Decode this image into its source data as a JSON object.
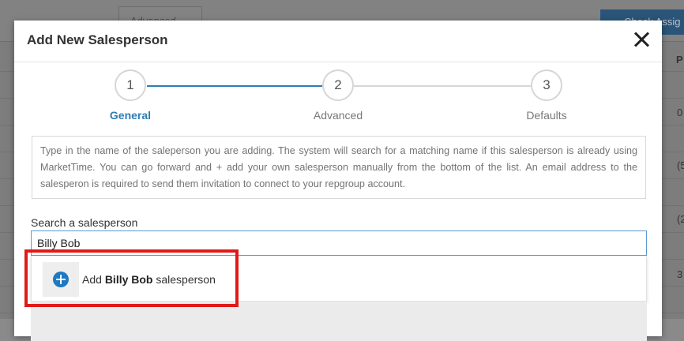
{
  "background": {
    "advanced_button": "Advanced ⌄",
    "check_button": "Check Assig",
    "column_header": "P",
    "cells": [
      "0",
      "(5",
      "(2",
      "3"
    ]
  },
  "modal": {
    "title": "Add New Salesperson",
    "steps": [
      {
        "number": "1",
        "label": "General",
        "active": true
      },
      {
        "number": "2",
        "label": "Advanced",
        "active": false
      },
      {
        "number": "3",
        "label": "Defaults",
        "active": false
      }
    ],
    "info_text": "Type in the name of the saleperson you are adding. The system will search for a matching name if this salesperson is already using MarketTime. You can go forward and + add your own salesperson manually from the bottom of the list. An email address to the salesperon is required to send them invitation to connect to your repgroup account.",
    "search": {
      "label": "Search a salesperson",
      "value": "Billy Bob"
    },
    "dropdown": {
      "prefix": "Add",
      "name": "Billy Bob",
      "suffix": "salesperson"
    }
  },
  "colors": {
    "accent": "#2c7db4",
    "highlight": "#e01919",
    "plus_icon": "#1e78c2"
  },
  "icons": [
    "close-icon",
    "plus-circle-icon"
  ]
}
